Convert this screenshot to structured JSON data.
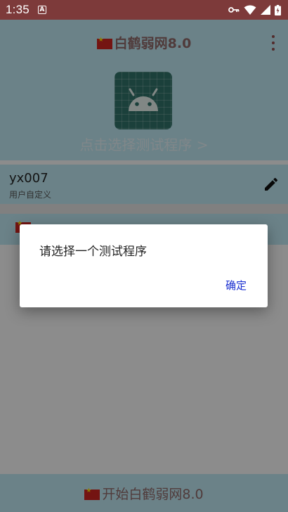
{
  "status_bar": {
    "time": "1:35",
    "notification": "A"
  },
  "app_bar": {
    "title": "白鹤弱网8.0"
  },
  "select_area": {
    "label": "点击选择测试程序 >"
  },
  "user_row": {
    "name": "yx007",
    "subtitle": "用户自定义"
  },
  "bottom_bar": {
    "label": "开始白鹤弱网8.0"
  },
  "dialog": {
    "message": "请选择一个测试程序",
    "ok_label": "确定"
  },
  "colors": {
    "status_bar": "#7d3a3a",
    "app_bar": "#b8e1ea",
    "dialog_button": "#1a2fd0"
  }
}
